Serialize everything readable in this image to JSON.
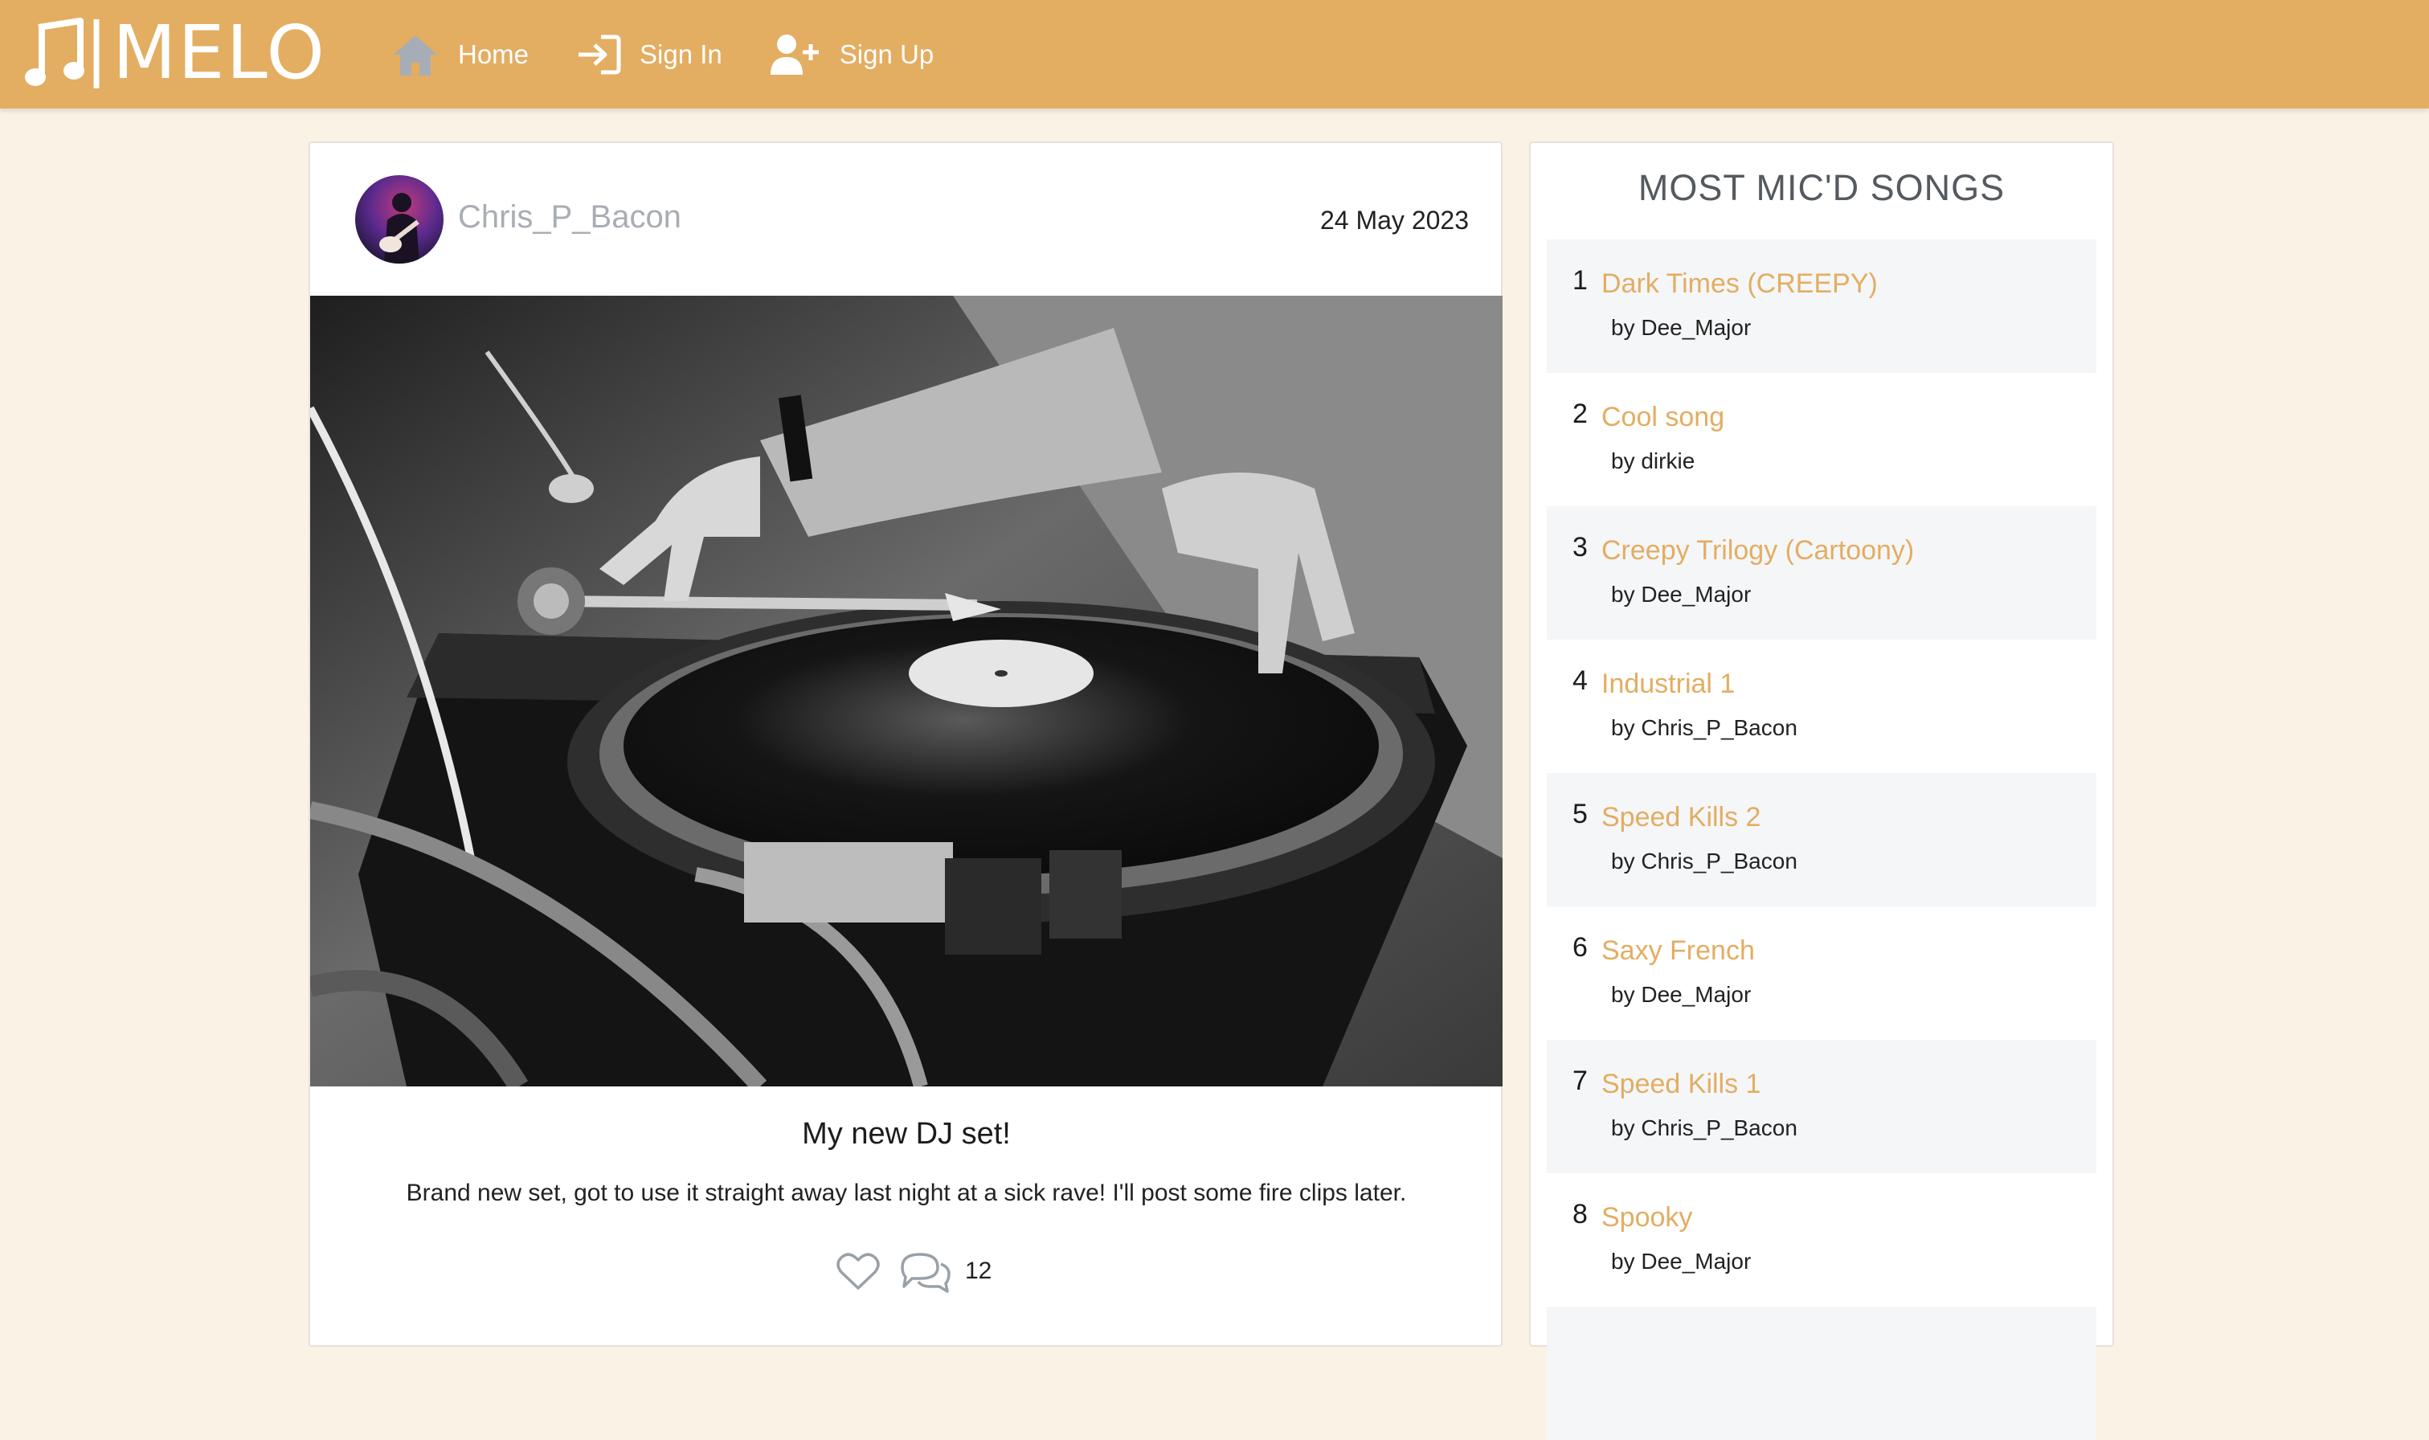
{
  "app": {
    "brand": "MELO"
  },
  "nav": [
    {
      "label": "Home",
      "icon": "home-icon"
    },
    {
      "label": "Sign In",
      "icon": "sign-in-icon"
    },
    {
      "label": "Sign Up",
      "icon": "user-plus-icon"
    }
  ],
  "post": {
    "username": "Chris_P_Bacon",
    "date": "24 May 2023",
    "title": "My new DJ set!",
    "body": "Brand new set, got to use it straight away last night at a sick rave! I'll post some fire clips later.",
    "comments_count": "12"
  },
  "sidebar": {
    "title": "MOST MIC'D SONGS",
    "songs": [
      {
        "rank": "1",
        "title": "Dark Times (CREEPY)",
        "artist": "by Dee_Major"
      },
      {
        "rank": "2",
        "title": "Cool song",
        "artist": "by dirkie"
      },
      {
        "rank": "3",
        "title": "Creepy Trilogy (Cartoony)",
        "artist": "by Dee_Major"
      },
      {
        "rank": "4",
        "title": "Industrial 1",
        "artist": "by Chris_P_Bacon"
      },
      {
        "rank": "5",
        "title": "Speed Kills 2",
        "artist": "by Chris_P_Bacon"
      },
      {
        "rank": "6",
        "title": "Saxy French",
        "artist": "by Dee_Major"
      },
      {
        "rank": "7",
        "title": "Speed Kills 1",
        "artist": "by Chris_P_Bacon"
      },
      {
        "rank": "8",
        "title": "Spooky",
        "artist": "by Dee_Major"
      }
    ]
  },
  "colors": {
    "navbar": "#e3ad62",
    "background": "#fbf2e6",
    "accent": "#e3ad62",
    "muted_username": "#a9adb4"
  }
}
